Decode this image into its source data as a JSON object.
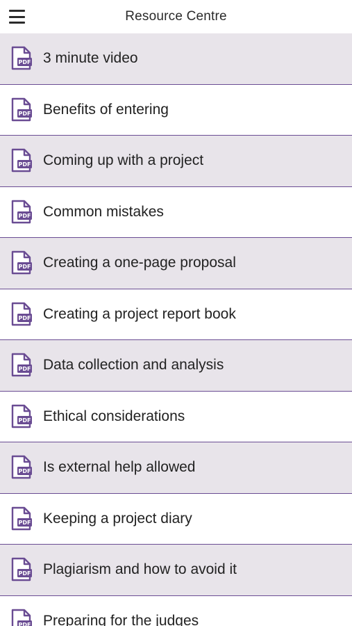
{
  "header": {
    "title": "Resource Centre",
    "menu_icon": "hamburger-menu-icon"
  },
  "colors": {
    "accent": "#6a4c93",
    "row_shaded": "#e8e4ea",
    "row_plain": "#ffffff"
  },
  "icon": {
    "name": "pdf-document-icon",
    "badge_text": "PDF"
  },
  "items": [
    {
      "label": "3 minute video"
    },
    {
      "label": "Benefits of entering"
    },
    {
      "label": "Coming up with a project"
    },
    {
      "label": "Common mistakes"
    },
    {
      "label": "Creating a one-page proposal"
    },
    {
      "label": "Creating a project report book"
    },
    {
      "label": "Data collection and analysis"
    },
    {
      "label": "Ethical considerations"
    },
    {
      "label": "Is external help allowed"
    },
    {
      "label": "Keeping a project diary"
    },
    {
      "label": "Plagiarism and how to avoid it"
    },
    {
      "label": "Preparing for the judges"
    }
  ]
}
